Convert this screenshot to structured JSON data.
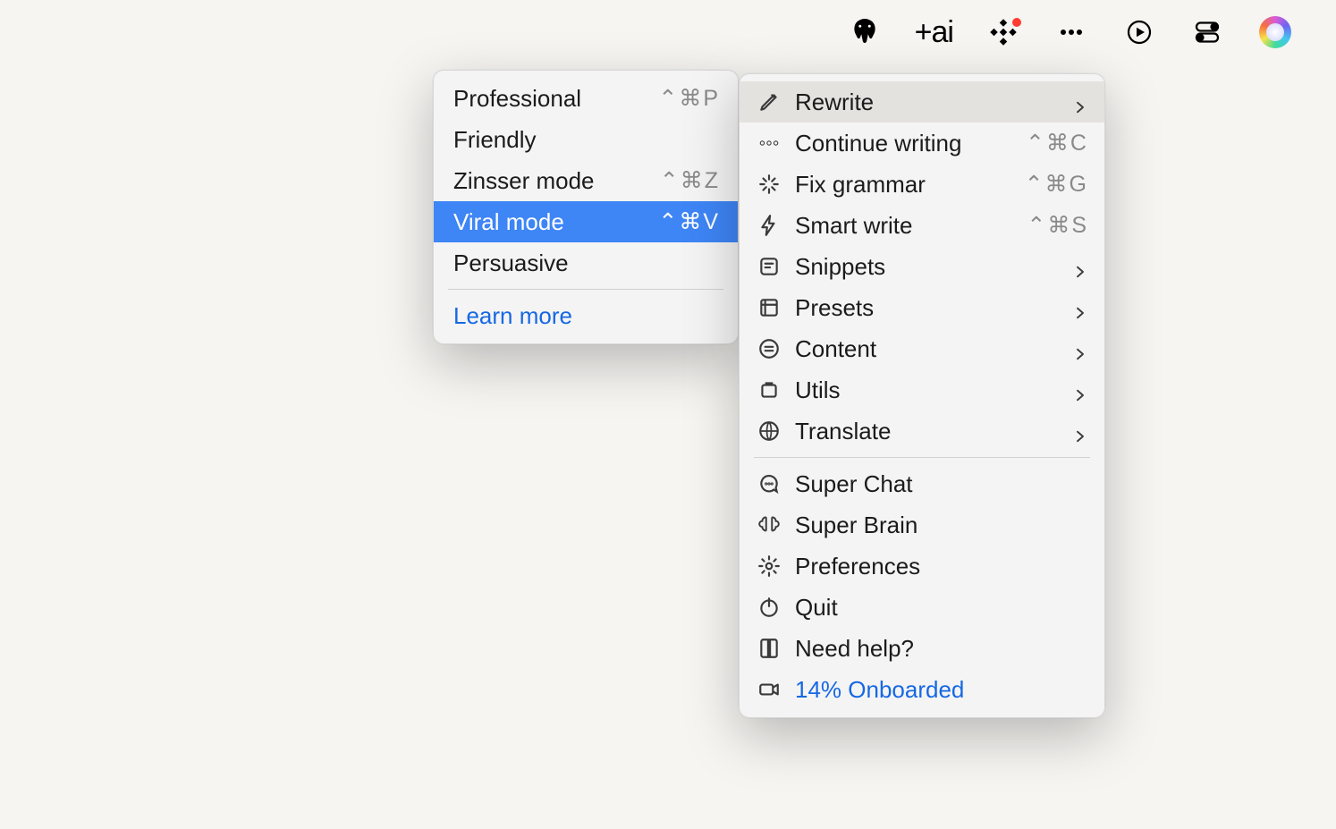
{
  "menubar": {
    "items": [
      "elephant-app",
      "plus-ai",
      "dots-app",
      "more",
      "play",
      "control-center",
      "siri"
    ],
    "ai_label": "+ai"
  },
  "main_menu": {
    "items": [
      {
        "icon": "pencil-icon",
        "label": "Rewrite",
        "shortcut": "",
        "submenu": true,
        "hover": true,
        "link": false
      },
      {
        "icon": "ellipsis-icon",
        "label": "Continue writing",
        "shortcut": "⌃⌘C",
        "submenu": false,
        "hover": false,
        "link": false
      },
      {
        "icon": "sparkle-icon",
        "label": "Fix grammar",
        "shortcut": "⌃⌘G",
        "submenu": false,
        "hover": false,
        "link": false
      },
      {
        "icon": "bolt-icon",
        "label": "Smart write",
        "shortcut": "⌃⌘S",
        "submenu": false,
        "hover": false,
        "link": false
      },
      {
        "icon": "snippet-icon",
        "label": "Snippets",
        "shortcut": "",
        "submenu": true,
        "hover": false,
        "link": false
      },
      {
        "icon": "presets-icon",
        "label": "Presets",
        "shortcut": "",
        "submenu": true,
        "hover": false,
        "link": false
      },
      {
        "icon": "content-icon",
        "label": "Content",
        "shortcut": "",
        "submenu": true,
        "hover": false,
        "link": false
      },
      {
        "icon": "utils-icon",
        "label": "Utils",
        "shortcut": "",
        "submenu": true,
        "hover": false,
        "link": false
      },
      {
        "icon": "translate-icon",
        "label": "Translate",
        "shortcut": "",
        "submenu": true,
        "hover": false,
        "link": false
      },
      {
        "sep": true
      },
      {
        "icon": "chat-icon",
        "label": "Super Chat",
        "shortcut": "",
        "submenu": false,
        "hover": false,
        "link": false
      },
      {
        "icon": "brain-icon",
        "label": "Super Brain",
        "shortcut": "",
        "submenu": false,
        "hover": false,
        "link": false
      },
      {
        "icon": "gear-icon",
        "label": "Preferences",
        "shortcut": "",
        "submenu": false,
        "hover": false,
        "link": false
      },
      {
        "icon": "power-icon",
        "label": "Quit",
        "shortcut": "",
        "submenu": false,
        "hover": false,
        "link": false
      },
      {
        "icon": "book-icon",
        "label": "Need help?",
        "shortcut": "",
        "submenu": false,
        "hover": false,
        "link": false
      },
      {
        "icon": "video-icon",
        "label": "14% Onboarded",
        "shortcut": "",
        "submenu": false,
        "hover": false,
        "link": true
      }
    ]
  },
  "sub_menu": {
    "items": [
      {
        "label": "Professional",
        "shortcut": "⌃⌘P",
        "selected": false
      },
      {
        "label": "Friendly",
        "shortcut": "",
        "selected": false
      },
      {
        "label": "Zinsser mode",
        "shortcut": "⌃⌘Z",
        "selected": false
      },
      {
        "label": "Viral mode",
        "shortcut": "⌃⌘V",
        "selected": true
      },
      {
        "label": "Persuasive",
        "shortcut": "",
        "selected": false
      },
      {
        "sep": true
      },
      {
        "label": "Learn more",
        "shortcut": "",
        "selected": false,
        "link": true
      }
    ]
  }
}
